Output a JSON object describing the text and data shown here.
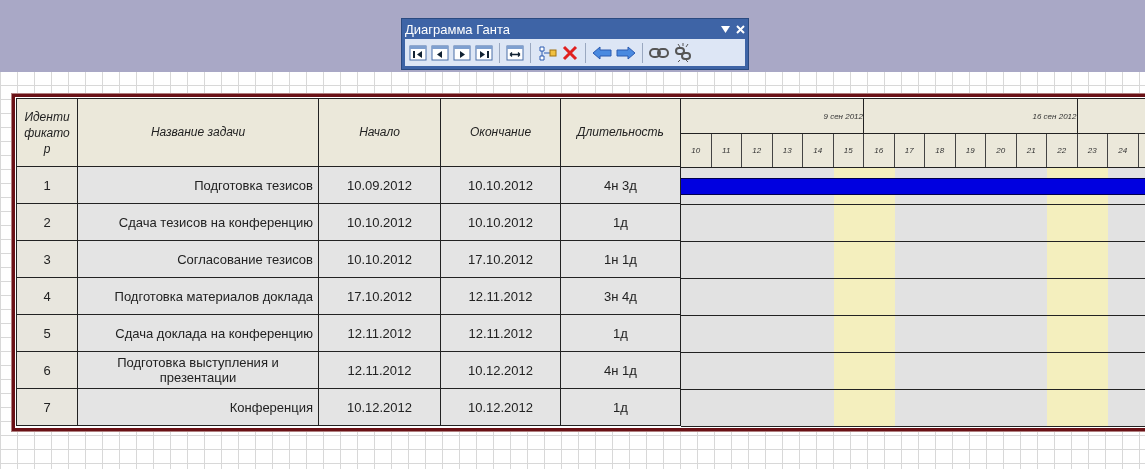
{
  "toolbar": {
    "title": "Диаграмма Ганта",
    "buttons": [
      {
        "kind": "first"
      },
      {
        "kind": "prev"
      },
      {
        "kind": "next"
      },
      {
        "kind": "last"
      },
      {
        "kind": "sep"
      },
      {
        "kind": "fit"
      },
      {
        "kind": "sep"
      },
      {
        "kind": "link_task"
      },
      {
        "kind": "delete"
      },
      {
        "kind": "sep"
      },
      {
        "kind": "left"
      },
      {
        "kind": "right"
      },
      {
        "kind": "sep"
      },
      {
        "kind": "link"
      },
      {
        "kind": "unlink"
      }
    ]
  },
  "table": {
    "columns": [
      "Идентификатор",
      "Название задачи",
      "Начало",
      "Окончание",
      "Длительность"
    ],
    "weeks": [
      {
        "label": "9 сен 2012",
        "days": [
          {
            "label": "10",
            "weekend": false
          },
          {
            "label": "11",
            "weekend": false
          },
          {
            "label": "12",
            "weekend": false
          },
          {
            "label": "13",
            "weekend": false
          },
          {
            "label": "14",
            "weekend": false
          },
          {
            "label": "15",
            "weekend": true
          }
        ]
      },
      {
        "label": "16 сен 2012",
        "days": [
          {
            "label": "16",
            "weekend": true
          },
          {
            "label": "17",
            "weekend": false
          },
          {
            "label": "18",
            "weekend": false
          },
          {
            "label": "19",
            "weekend": false
          },
          {
            "label": "20",
            "weekend": false
          },
          {
            "label": "21",
            "weekend": false
          },
          {
            "label": "22",
            "weekend": true
          }
        ]
      },
      {
        "days": [
          {
            "label": "23",
            "weekend": true
          },
          {
            "label": "24",
            "weekend": false
          },
          {
            "weekend": false
          }
        ]
      }
    ],
    "rows": [
      {
        "id": "1",
        "name": "Подготовка тезисов",
        "start": "10.09.2012",
        "end": "10.10.2012",
        "duration": "4н 3д",
        "bar": true
      },
      {
        "id": "2",
        "name": "Сдача тезисов на конференцию",
        "start": "10.10.2012",
        "end": "10.10.2012",
        "duration": "1д"
      },
      {
        "id": "3",
        "name": "Согласование тезисов",
        "start": "10.10.2012",
        "end": "17.10.2012",
        "duration": "1н 1д"
      },
      {
        "id": "4",
        "name": "Подготовка материалов доклада",
        "start": "17.10.2012",
        "end": "12.11.2012",
        "duration": "3н 4д"
      },
      {
        "id": "5",
        "name": "Сдача доклада на конференцию",
        "start": "12.11.2012",
        "end": "12.11.2012",
        "duration": "1д"
      },
      {
        "id": "6",
        "name": "Подготовка выступления и презентации",
        "start": "12.11.2012",
        "end": "10.12.2012",
        "duration": "4н 1д"
      },
      {
        "id": "7",
        "name": "Конференция",
        "start": "10.12.2012",
        "end": "10.12.2012",
        "duration": "1д"
      }
    ]
  }
}
